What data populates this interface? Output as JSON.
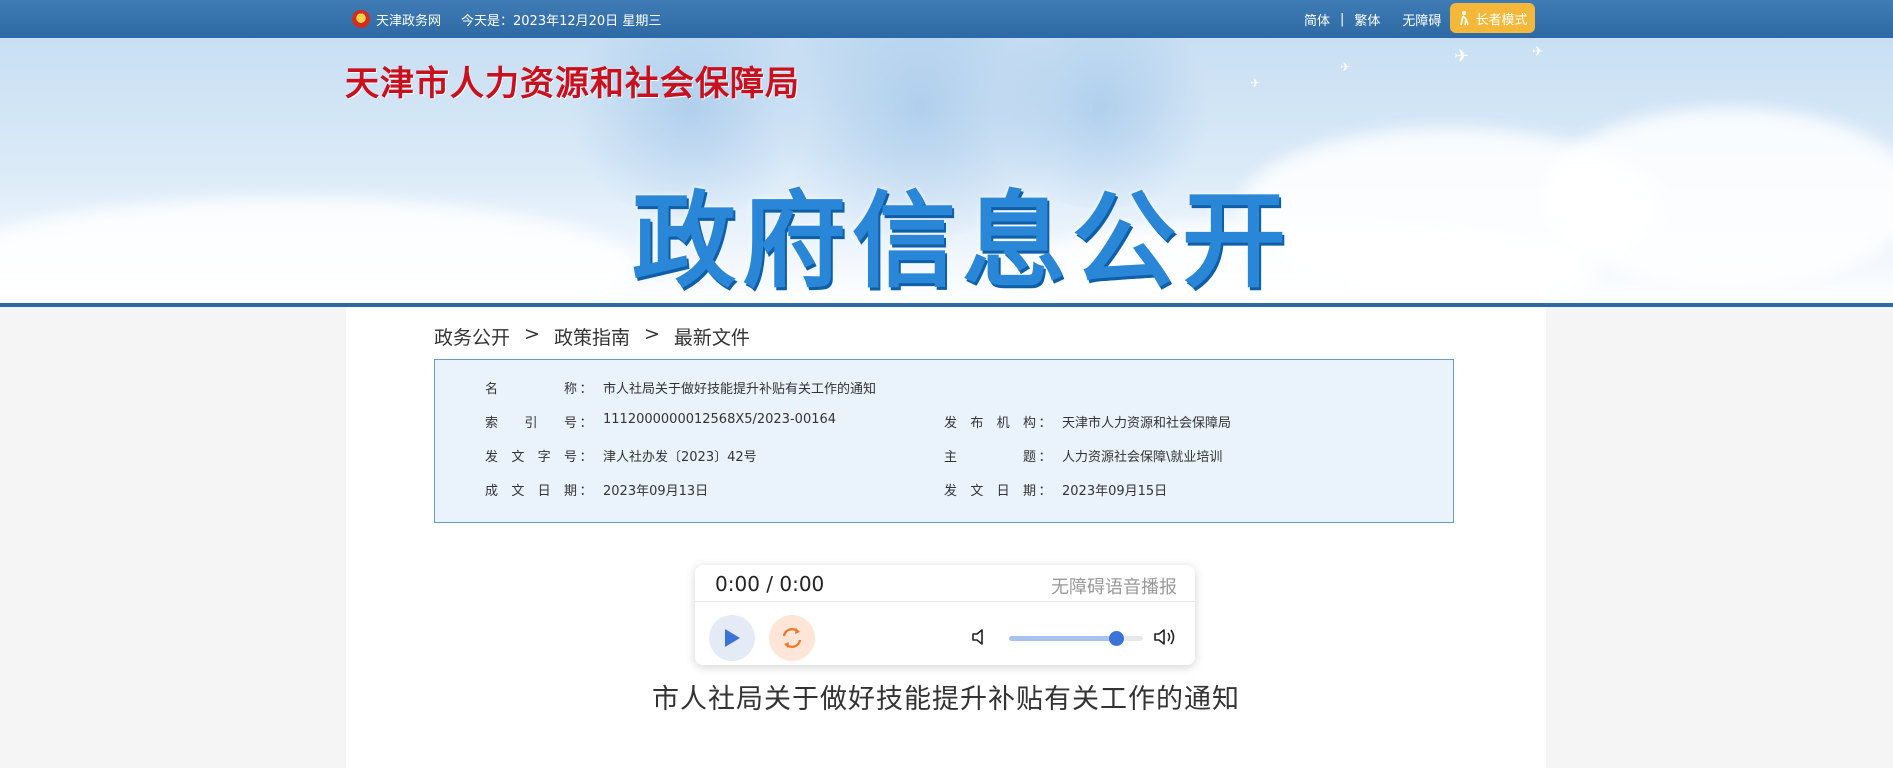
{
  "topbar": {
    "site_name": "天津政务网",
    "date_text": "今天是：2023年12月20日 星期三",
    "links": [
      "简体",
      "繁体",
      "无障碍"
    ],
    "separator": "|",
    "elder_mode": "长者模式"
  },
  "banner": {
    "org_name": "天津市人力资源和社会保障局",
    "big_title": "政府信息公开"
  },
  "breadcrumb": {
    "items": [
      "政务公开",
      "政策指南",
      "最新文件"
    ],
    "separator": ">"
  },
  "meta": {
    "name_label": "名称",
    "name_value": "市人社局关于做好技能提升补贴有关工作的通知",
    "index_label": "索引号",
    "index_value": "1112000000012568X5/2023-00164",
    "issuer_label": "发布机构",
    "issuer_value": "天津市人力资源和社会保障局",
    "docno_label": "发文字号",
    "docno_value": "津人社办发〔2023〕42号",
    "topic_label": "主题",
    "topic_value": "人力资源社会保障\\就业培训",
    "created_label": "成文日期",
    "created_value": "2023年09月13日",
    "published_label": "发文日期",
    "published_value": "2023年09月15日",
    "colon": "："
  },
  "player": {
    "time": "0:00 / 0:00",
    "label": "无障碍语音播报",
    "volume": 0.8,
    "accent_color": "#3b73d9"
  },
  "document": {
    "title": "市人社局关于做好技能提升补贴有关工作的通知"
  }
}
